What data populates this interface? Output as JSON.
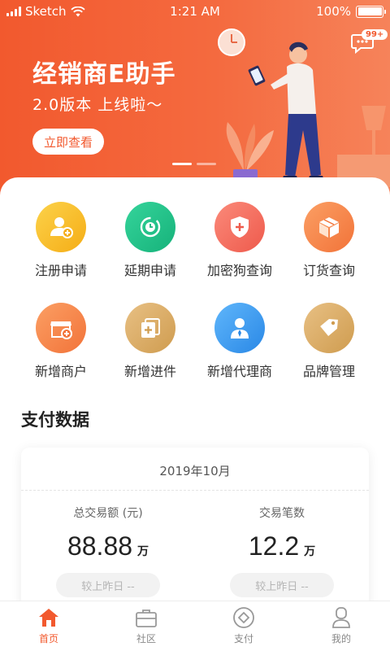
{
  "status_bar": {
    "carrier": "Sketch",
    "time": "1:21 AM",
    "battery": "100%"
  },
  "banner": {
    "title": "经销商E助手",
    "subtitle": "2.0版本 上线啦～",
    "button_label": "立即查看",
    "message_badge": "99+",
    "slide_count": 2,
    "active_slide": 1
  },
  "menu": [
    {
      "label": "注册申请",
      "icon": "user-plus-icon",
      "color": "#f7b81f"
    },
    {
      "label": "延期申请",
      "icon": "clock-refresh-icon",
      "color": "#22c08a"
    },
    {
      "label": "加密狗查询",
      "icon": "shield-plus-icon",
      "color": "#f36a5c"
    },
    {
      "label": "订货查询",
      "icon": "package-box-icon",
      "color": "#f4844a"
    },
    {
      "label": "新增商户",
      "icon": "store-plus-icon",
      "color": "#f4844a"
    },
    {
      "label": "新增进件",
      "icon": "document-plus-icon",
      "color": "#dcab63"
    },
    {
      "label": "新增代理商",
      "icon": "agent-person-icon",
      "color": "#3c9ef0"
    },
    {
      "label": "品牌管理",
      "icon": "tag-icon",
      "color": "#dcab63"
    }
  ],
  "payment": {
    "section_title": "支付数据",
    "date": "2019年10月",
    "total_amount": {
      "label": "总交易额 (元)",
      "value": "88.88",
      "unit": "万",
      "compare": "较上昨日 --"
    },
    "transaction_count": {
      "label": "交易笔数",
      "value": "12.2",
      "unit": "万",
      "compare": "较上昨日 --"
    }
  },
  "tabs": [
    {
      "label": "首页",
      "icon": "home-icon",
      "active": true
    },
    {
      "label": "社区",
      "icon": "briefcase-icon",
      "active": false
    },
    {
      "label": "支付",
      "icon": "payment-diamond-icon",
      "active": false
    },
    {
      "label": "我的",
      "icon": "profile-icon",
      "active": false
    }
  ],
  "colors": {
    "accent": "#f2592e",
    "banner_end": "#f6835a"
  }
}
